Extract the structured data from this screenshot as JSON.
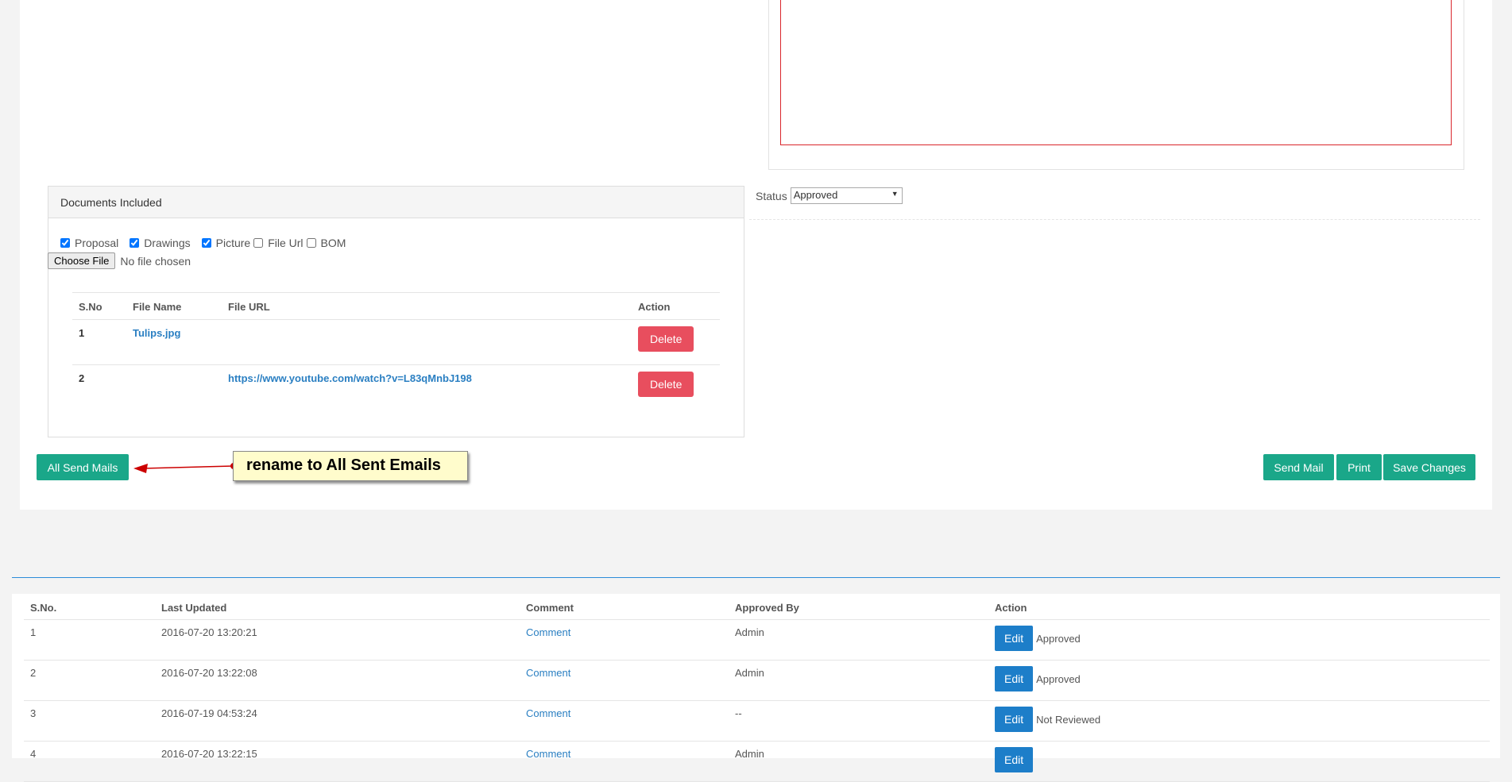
{
  "documents": {
    "title": "Documents Included",
    "checkboxes": [
      {
        "label": "Proposal",
        "checked": true
      },
      {
        "label": "Drawings",
        "checked": true
      },
      {
        "label": "Picture",
        "checked": true
      },
      {
        "label": "File Url",
        "checked": false
      },
      {
        "label": "BOM",
        "checked": false
      }
    ],
    "choose_file_label": "Choose File",
    "no_file_text": "No file chosen",
    "columns": {
      "sno": "S.No",
      "file_name": "File Name",
      "file_url": "File URL",
      "action": "Action"
    },
    "rows": [
      {
        "sno": "1",
        "file_name": "Tulips.jpg",
        "file_url": "",
        "action": "Delete"
      },
      {
        "sno": "2",
        "file_name": "",
        "file_url": "https://www.youtube.com/watch?v=L83qMnbJ198",
        "action": "Delete"
      }
    ]
  },
  "status": {
    "label": "Status",
    "value": "Approved"
  },
  "buttons": {
    "all_send_mails": "All Send Mails",
    "send_mail": "Send Mail",
    "print": "Print",
    "save_changes": "Save Changes"
  },
  "annotation": {
    "text": "rename to All Sent Emails",
    "color": "#cc0000"
  },
  "history": {
    "columns": {
      "sno": "S.No.",
      "last_updated": "Last Updated",
      "comment": "Comment",
      "approved_by": "Approved By",
      "action": "Action"
    },
    "rows": [
      {
        "sno": "1",
        "last_updated": "2016-07-20 13:20:21",
        "comment": "Comment",
        "approved_by": "Admin",
        "edit": "Edit",
        "status": "Approved"
      },
      {
        "sno": "2",
        "last_updated": "2016-07-20 13:22:08",
        "comment": "Comment",
        "approved_by": "Admin",
        "edit": "Edit",
        "status": "Approved"
      },
      {
        "sno": "3",
        "last_updated": "2016-07-19 04:53:24",
        "comment": "Comment",
        "approved_by": "--",
        "edit": "Edit",
        "status": "Not Reviewed"
      },
      {
        "sno": "4",
        "last_updated": "2016-07-20 13:22:15",
        "comment": "Comment",
        "approved_by": "Admin",
        "edit": "Edit",
        "status": ""
      }
    ]
  },
  "colors": {
    "primary_green": "#1aa789",
    "danger": "#e84e5e",
    "edit_blue": "#1d7ec9",
    "link": "#2a7fc2",
    "divider_blue": "#2a8bd8"
  }
}
